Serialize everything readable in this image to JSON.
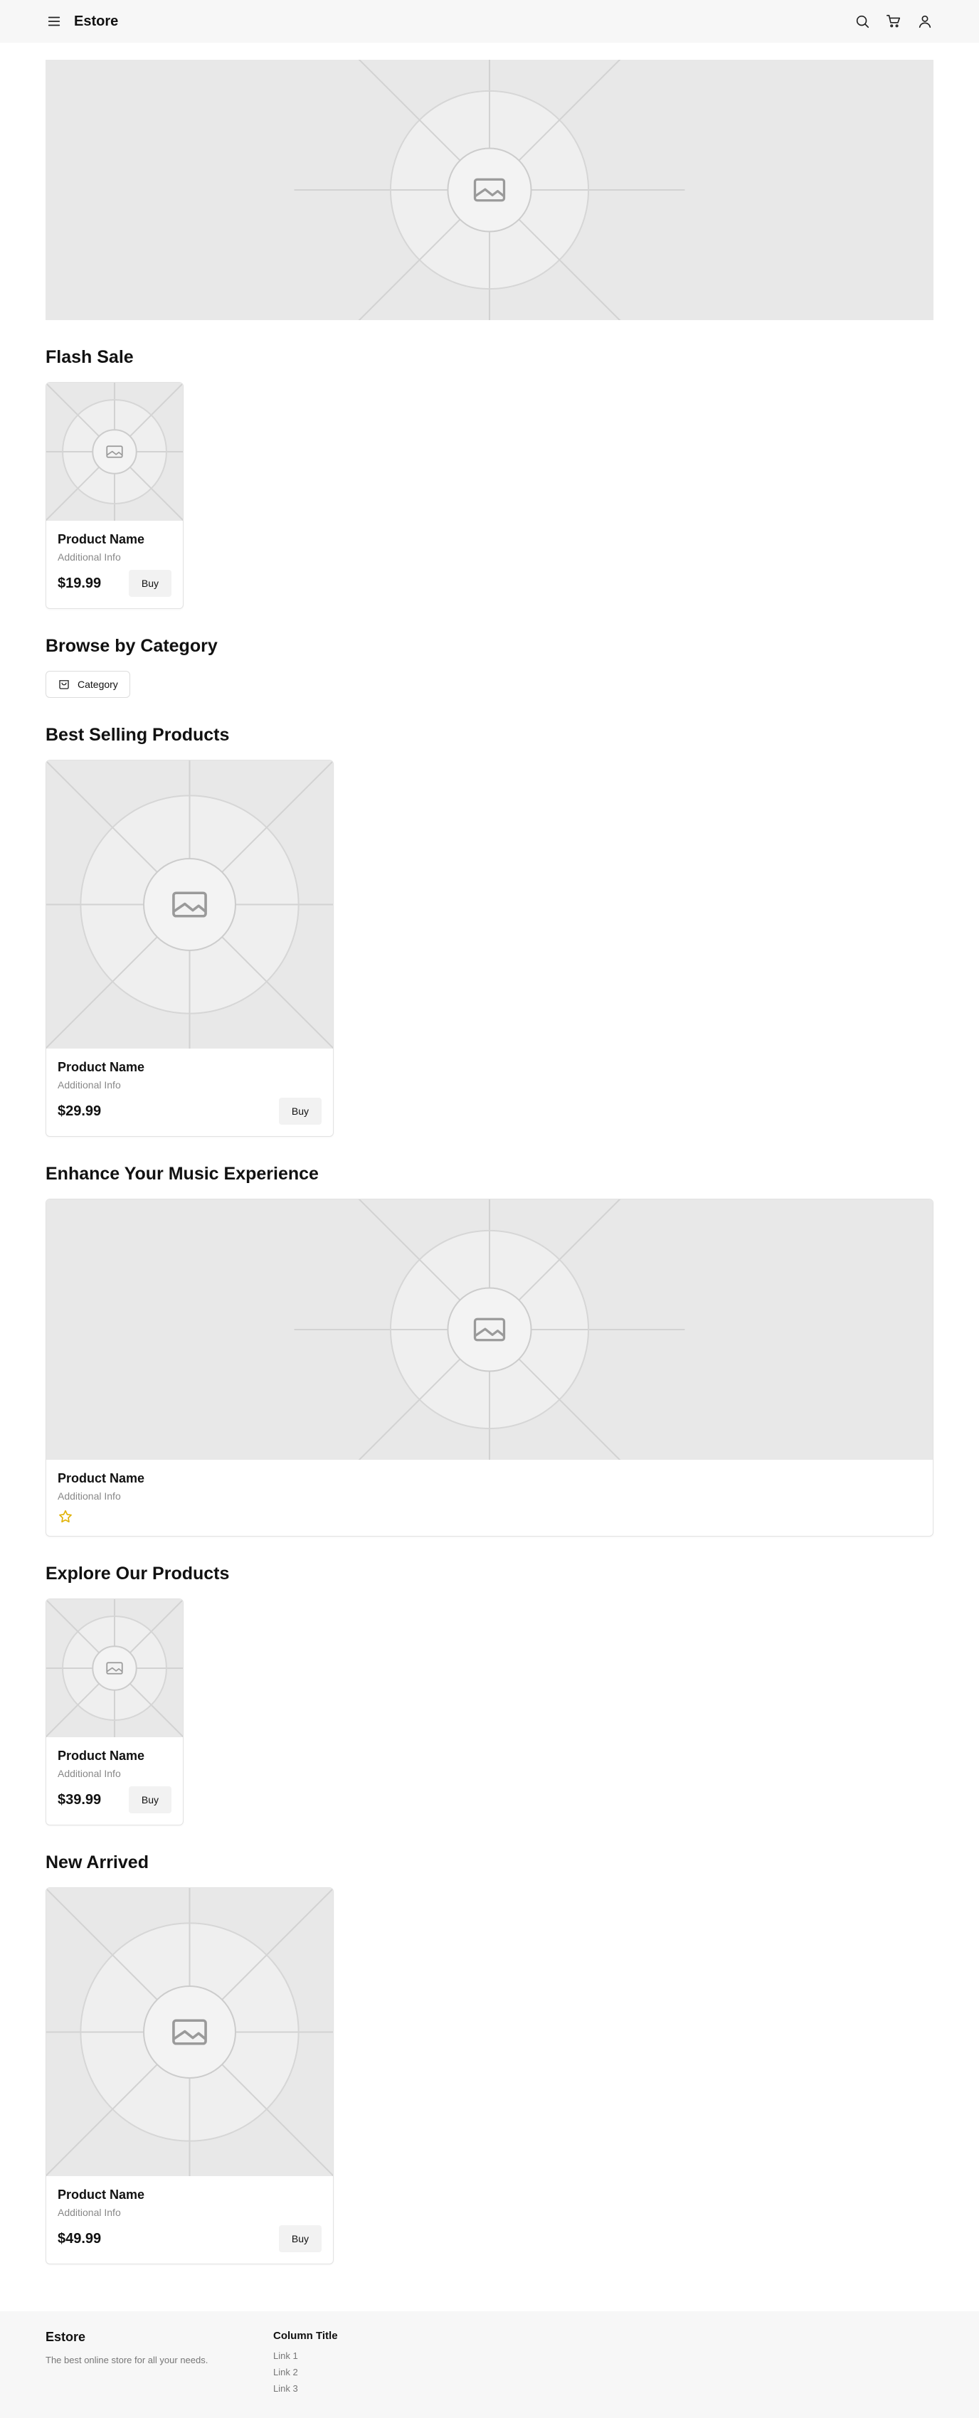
{
  "header": {
    "brand": "Estore",
    "icons": [
      "menu-icon",
      "search-icon",
      "cart-icon",
      "user-icon"
    ]
  },
  "sections": {
    "flash_sale": "Flash Sale",
    "browse_by_category": "Browse by Category",
    "best_selling": "Best Selling Products",
    "music": "Enhance Your Music Experience",
    "explore": "Explore Our Products",
    "new_arrived": "New Arrived"
  },
  "category": {
    "label": "Category",
    "icon": "bag-icon"
  },
  "products": {
    "flash": {
      "name": "Product Name",
      "info": "Additional Info",
      "price": "$19.99",
      "buy": "Buy"
    },
    "best": {
      "name": "Product Name",
      "info": "Additional Info",
      "price": "$29.99",
      "buy": "Buy"
    },
    "music": {
      "name": "Product Name",
      "info": "Additional Info",
      "rating_icon": "star-icon"
    },
    "explore": {
      "name": "Product Name",
      "info": "Additional Info",
      "price": "$39.99",
      "buy": "Buy"
    },
    "new": {
      "name": "Product Name",
      "info": "Additional Info",
      "price": "$49.99",
      "buy": "Buy"
    }
  },
  "footer": {
    "brand": "Estore",
    "tagline": "The best online store for all your needs.",
    "column_title": "Column Title",
    "links": [
      "Link 1",
      "Link 2",
      "Link 3"
    ]
  },
  "colors": {
    "header_bg": "#f7f7f7",
    "placeholder_bg": "#e8e8e8",
    "star": "#e0b100"
  }
}
